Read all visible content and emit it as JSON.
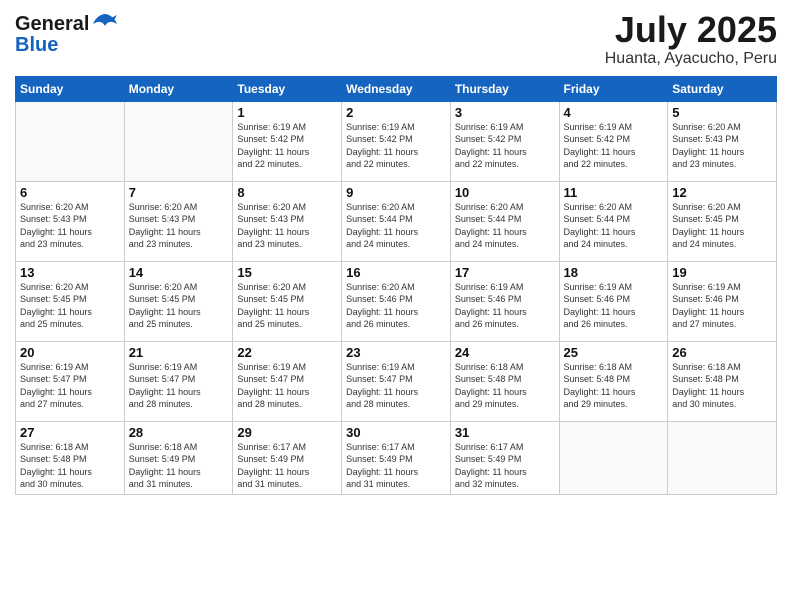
{
  "header": {
    "logo_general": "General",
    "logo_blue": "Blue",
    "month": "July 2025",
    "location": "Huanta, Ayacucho, Peru"
  },
  "weekdays": [
    "Sunday",
    "Monday",
    "Tuesday",
    "Wednesday",
    "Thursday",
    "Friday",
    "Saturday"
  ],
  "weeks": [
    [
      {
        "day": "",
        "info": ""
      },
      {
        "day": "",
        "info": ""
      },
      {
        "day": "1",
        "info": "Sunrise: 6:19 AM\nSunset: 5:42 PM\nDaylight: 11 hours\nand 22 minutes."
      },
      {
        "day": "2",
        "info": "Sunrise: 6:19 AM\nSunset: 5:42 PM\nDaylight: 11 hours\nand 22 minutes."
      },
      {
        "day": "3",
        "info": "Sunrise: 6:19 AM\nSunset: 5:42 PM\nDaylight: 11 hours\nand 22 minutes."
      },
      {
        "day": "4",
        "info": "Sunrise: 6:19 AM\nSunset: 5:42 PM\nDaylight: 11 hours\nand 22 minutes."
      },
      {
        "day": "5",
        "info": "Sunrise: 6:20 AM\nSunset: 5:43 PM\nDaylight: 11 hours\nand 23 minutes."
      }
    ],
    [
      {
        "day": "6",
        "info": "Sunrise: 6:20 AM\nSunset: 5:43 PM\nDaylight: 11 hours\nand 23 minutes."
      },
      {
        "day": "7",
        "info": "Sunrise: 6:20 AM\nSunset: 5:43 PM\nDaylight: 11 hours\nand 23 minutes."
      },
      {
        "day": "8",
        "info": "Sunrise: 6:20 AM\nSunset: 5:43 PM\nDaylight: 11 hours\nand 23 minutes."
      },
      {
        "day": "9",
        "info": "Sunrise: 6:20 AM\nSunset: 5:44 PM\nDaylight: 11 hours\nand 24 minutes."
      },
      {
        "day": "10",
        "info": "Sunrise: 6:20 AM\nSunset: 5:44 PM\nDaylight: 11 hours\nand 24 minutes."
      },
      {
        "day": "11",
        "info": "Sunrise: 6:20 AM\nSunset: 5:44 PM\nDaylight: 11 hours\nand 24 minutes."
      },
      {
        "day": "12",
        "info": "Sunrise: 6:20 AM\nSunset: 5:45 PM\nDaylight: 11 hours\nand 24 minutes."
      }
    ],
    [
      {
        "day": "13",
        "info": "Sunrise: 6:20 AM\nSunset: 5:45 PM\nDaylight: 11 hours\nand 25 minutes."
      },
      {
        "day": "14",
        "info": "Sunrise: 6:20 AM\nSunset: 5:45 PM\nDaylight: 11 hours\nand 25 minutes."
      },
      {
        "day": "15",
        "info": "Sunrise: 6:20 AM\nSunset: 5:45 PM\nDaylight: 11 hours\nand 25 minutes."
      },
      {
        "day": "16",
        "info": "Sunrise: 6:20 AM\nSunset: 5:46 PM\nDaylight: 11 hours\nand 26 minutes."
      },
      {
        "day": "17",
        "info": "Sunrise: 6:19 AM\nSunset: 5:46 PM\nDaylight: 11 hours\nand 26 minutes."
      },
      {
        "day": "18",
        "info": "Sunrise: 6:19 AM\nSunset: 5:46 PM\nDaylight: 11 hours\nand 26 minutes."
      },
      {
        "day": "19",
        "info": "Sunrise: 6:19 AM\nSunset: 5:46 PM\nDaylight: 11 hours\nand 27 minutes."
      }
    ],
    [
      {
        "day": "20",
        "info": "Sunrise: 6:19 AM\nSunset: 5:47 PM\nDaylight: 11 hours\nand 27 minutes."
      },
      {
        "day": "21",
        "info": "Sunrise: 6:19 AM\nSunset: 5:47 PM\nDaylight: 11 hours\nand 28 minutes."
      },
      {
        "day": "22",
        "info": "Sunrise: 6:19 AM\nSunset: 5:47 PM\nDaylight: 11 hours\nand 28 minutes."
      },
      {
        "day": "23",
        "info": "Sunrise: 6:19 AM\nSunset: 5:47 PM\nDaylight: 11 hours\nand 28 minutes."
      },
      {
        "day": "24",
        "info": "Sunrise: 6:18 AM\nSunset: 5:48 PM\nDaylight: 11 hours\nand 29 minutes."
      },
      {
        "day": "25",
        "info": "Sunrise: 6:18 AM\nSunset: 5:48 PM\nDaylight: 11 hours\nand 29 minutes."
      },
      {
        "day": "26",
        "info": "Sunrise: 6:18 AM\nSunset: 5:48 PM\nDaylight: 11 hours\nand 30 minutes."
      }
    ],
    [
      {
        "day": "27",
        "info": "Sunrise: 6:18 AM\nSunset: 5:48 PM\nDaylight: 11 hours\nand 30 minutes."
      },
      {
        "day": "28",
        "info": "Sunrise: 6:18 AM\nSunset: 5:49 PM\nDaylight: 11 hours\nand 31 minutes."
      },
      {
        "day": "29",
        "info": "Sunrise: 6:17 AM\nSunset: 5:49 PM\nDaylight: 11 hours\nand 31 minutes."
      },
      {
        "day": "30",
        "info": "Sunrise: 6:17 AM\nSunset: 5:49 PM\nDaylight: 11 hours\nand 31 minutes."
      },
      {
        "day": "31",
        "info": "Sunrise: 6:17 AM\nSunset: 5:49 PM\nDaylight: 11 hours\nand 32 minutes."
      },
      {
        "day": "",
        "info": ""
      },
      {
        "day": "",
        "info": ""
      }
    ]
  ]
}
